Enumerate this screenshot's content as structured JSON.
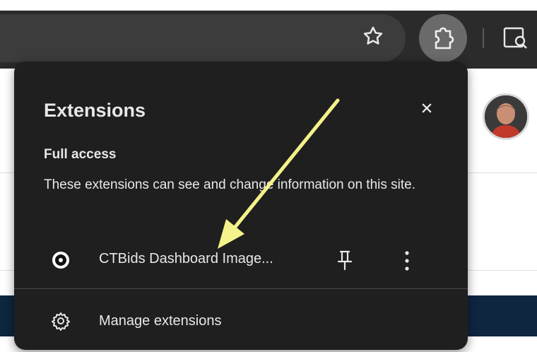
{
  "popup": {
    "title": "Extensions",
    "section_heading": "Full access",
    "section_description": "These extensions can see and change information on this site.",
    "extension": {
      "name": "CTBids Dashboard Image..."
    },
    "manage_label": "Manage extensions"
  },
  "icons": {
    "toolbar": [
      "star-icon",
      "extensions-puzzle-icon",
      "search-tab-icon"
    ],
    "popup": [
      "close-icon",
      "extension-logo-icon",
      "pin-icon",
      "more-vert-icon",
      "gear-icon"
    ]
  },
  "annotation": {
    "arrow_color": "#f4f28a"
  },
  "colors": {
    "popup_bg": "#1f1f1f",
    "toolbar_bg": "#2b2b2b",
    "page_band": "#0e2640"
  }
}
